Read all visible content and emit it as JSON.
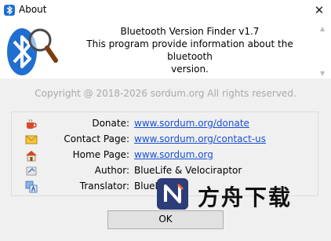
{
  "window": {
    "title": "About",
    "close_label": "✕"
  },
  "header": {
    "line1": "Bluetooth Version Finder v1.7",
    "line2": "This program provide information about the bluetooth",
    "line3": "version."
  },
  "copyright": "Copyright @ 2018-2026 sordum.org All rights reserved.",
  "info": {
    "donate_label": "Donate:",
    "donate_value": "www.sordum.org/donate",
    "contact_label": "Contact Page:",
    "contact_value": "www.sordum.org/contact-us",
    "home_label": "Home Page:",
    "home_value": "www.sordum.org",
    "author_label": "Author:",
    "author_value": "BlueLife & Velociraptor",
    "translator_label": "Translator:",
    "translator_value": "BlueLife"
  },
  "ok_label": "OK",
  "watermark": {
    "text": "方舟下载"
  },
  "colors": {
    "link": "#1a4fd6",
    "bluetooth_blue": "#1f6fd0",
    "copyright_gray": "#a9a9a9"
  }
}
